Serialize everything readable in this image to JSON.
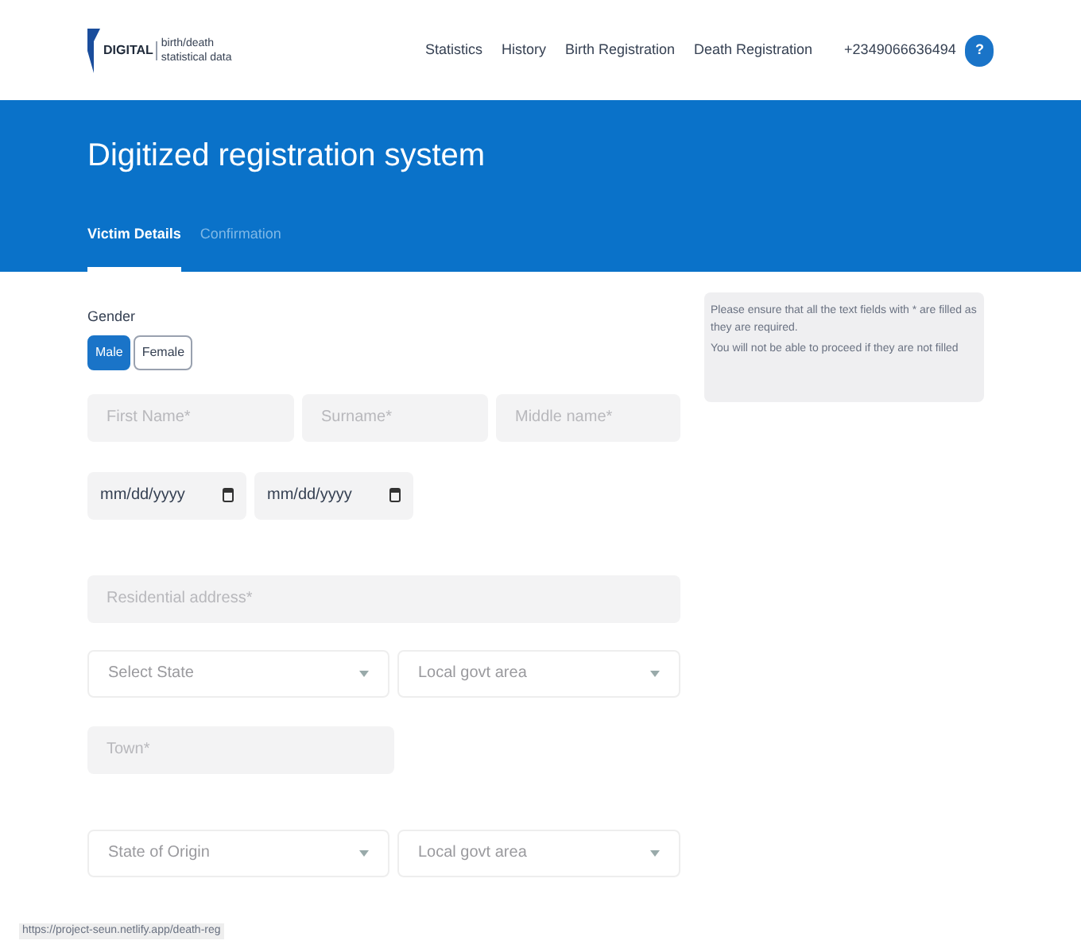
{
  "header": {
    "logo_mark": "DIGITAL",
    "logo_text": [
      "birth/death",
      "statistical data"
    ],
    "nav": [
      "Statistics",
      "History",
      "Birth Registration",
      "Death Registration"
    ],
    "phone": "+2349066636494",
    "avatar": "?"
  },
  "banner": {
    "title": "Digitized registration system",
    "tabs": [
      {
        "label": "Victim Details",
        "selected": true
      },
      {
        "label": "Confirmation",
        "selected": false
      }
    ]
  },
  "form": {
    "gender_label": "Gender",
    "gender": [
      {
        "label": "Male",
        "selected": true
      },
      {
        "label": "Female",
        "selected": false
      }
    ],
    "rows": [
      {
        "kind": "inputs",
        "fields": [
          {
            "placeholder": "First Name*"
          },
          {
            "placeholder": "Surname*"
          },
          {
            "placeholder": "Middle name*"
          }
        ]
      },
      {
        "kind": "dates",
        "fields": [
          {
            "value": "mm/dd/yyyy"
          },
          {
            "value": "mm/dd/yyyy"
          }
        ]
      },
      {
        "kind": "wide",
        "fields": [
          {
            "placeholder": "Residential address*"
          }
        ]
      },
      {
        "kind": "selects",
        "fields": [
          {
            "placeholder": "Select State"
          },
          {
            "placeholder": "Local govt area"
          }
        ]
      },
      {
        "kind": "half",
        "fields": [
          {
            "placeholder": "Town*"
          }
        ]
      },
      {
        "kind": "selects",
        "fields": [
          {
            "placeholder": "State of Origin"
          },
          {
            "placeholder": "Local govt area"
          }
        ]
      }
    ]
  },
  "notice": [
    "Please ensure that all the text fields with * are filled as they are required.",
    "You will not be able to proceed if they are not filled"
  ],
  "status_url": "https://project-seun.netlify.app/death-reg"
}
